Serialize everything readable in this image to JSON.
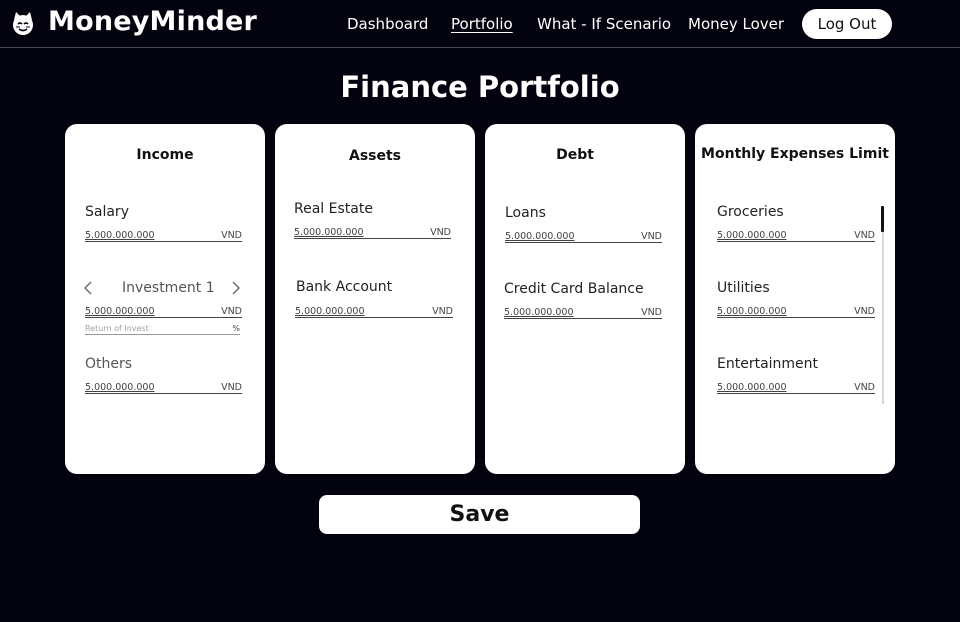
{
  "app": {
    "brand": "MoneyMinder",
    "logo_icon": "cat-head-icon"
  },
  "nav": {
    "items": [
      {
        "label": "Dashboard",
        "active": false
      },
      {
        "label": "Portfolio",
        "active": true
      },
      {
        "label": "What - If Scenario",
        "active": false
      },
      {
        "label": "Money Lover",
        "active": false
      }
    ],
    "logout_label": "Log Out"
  },
  "page": {
    "title": "Finance Portfolio"
  },
  "income": {
    "title": "Income",
    "salary": {
      "label": "Salary",
      "value": "5.000.000.000",
      "unit": "VND"
    },
    "investment": {
      "label": "Investment 1",
      "value": "5.000.000.000",
      "unit": "VND",
      "return_placeholder": "Return of Invest",
      "return_unit": "%",
      "prev_icon": "chevron-left-icon",
      "next_icon": "chevron-right-icon"
    },
    "others": {
      "label": "Others",
      "value": "5.000.000.000",
      "unit": "VND"
    }
  },
  "assets": {
    "title": "Assets",
    "real_estate": {
      "label": "Real Estate",
      "value": "5.000.000.000",
      "unit": "VND"
    },
    "bank_account": {
      "label": "Bank Account",
      "value": "5.000.000.000",
      "unit": "VND"
    }
  },
  "debt": {
    "title": "Debt",
    "loans": {
      "label": "Loans",
      "value": "5.000.000.000",
      "unit": "VND"
    },
    "credit_card": {
      "label": "Credit Card Balance",
      "value": "5.000.000.000",
      "unit": "VND"
    }
  },
  "expenses": {
    "title": "Monthly Expenses Limit",
    "groceries": {
      "label": "Groceries",
      "value": "5.000.000.000",
      "unit": "VND"
    },
    "utilities": {
      "label": "Utilities",
      "value": "5.000.000.000",
      "unit": "VND"
    },
    "entertainment": {
      "label": "Entertainment",
      "value": "5.000.000.000",
      "unit": "VND"
    }
  },
  "actions": {
    "save_label": "Save"
  },
  "colors": {
    "background": "#03030f",
    "card": "#ffffff",
    "text_on_dark": "#ffffff"
  }
}
